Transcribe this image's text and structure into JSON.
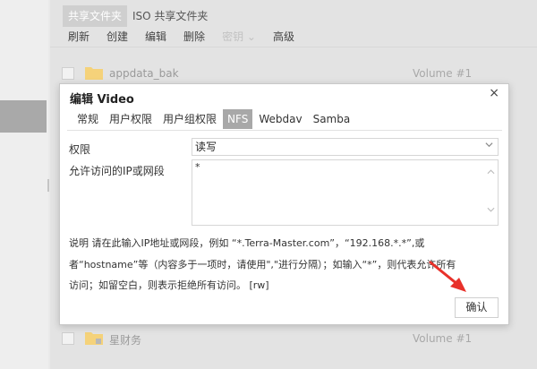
{
  "tabs": [
    {
      "label": "共享文件夹"
    },
    {
      "label": "ISO 共享文件夹"
    }
  ],
  "toolbar": {
    "refresh": "刷新",
    "create": "创建",
    "edit": "编辑",
    "delete": "删除",
    "encrypt": "密钥",
    "advanced": "高级"
  },
  "rows": [
    {
      "name": "appdata_bak",
      "volume": "Volume #1"
    },
    {
      "name": "星财务",
      "volume": "Volume #1"
    }
  ],
  "dialog": {
    "title": "编辑 Video",
    "close": "×",
    "tabs": [
      "常规",
      "用户权限",
      "用户组权限",
      "NFS",
      "Webdav",
      "Samba"
    ],
    "active_tab": "NFS",
    "perm_label": "权限",
    "perm_value": "读写",
    "ip_label": "允许访问的IP或网段",
    "ip_value": "*",
    "note_line1": "说明 请在此输入IP地址或网段，例如 “*.Terra-Master.com”，“192.168.*.*”,或",
    "note_line2": "者“hostname”等（内容多于一项时，请使用\",\"进行分隔）；如输入“*”，则代表允许所有",
    "note_line3": "访问；如留空白，则表示拒绝所有访问。 [rw]",
    "confirm": "确认"
  },
  "colors": {
    "arrow": "#e8312a",
    "folder": "#f5c445"
  }
}
